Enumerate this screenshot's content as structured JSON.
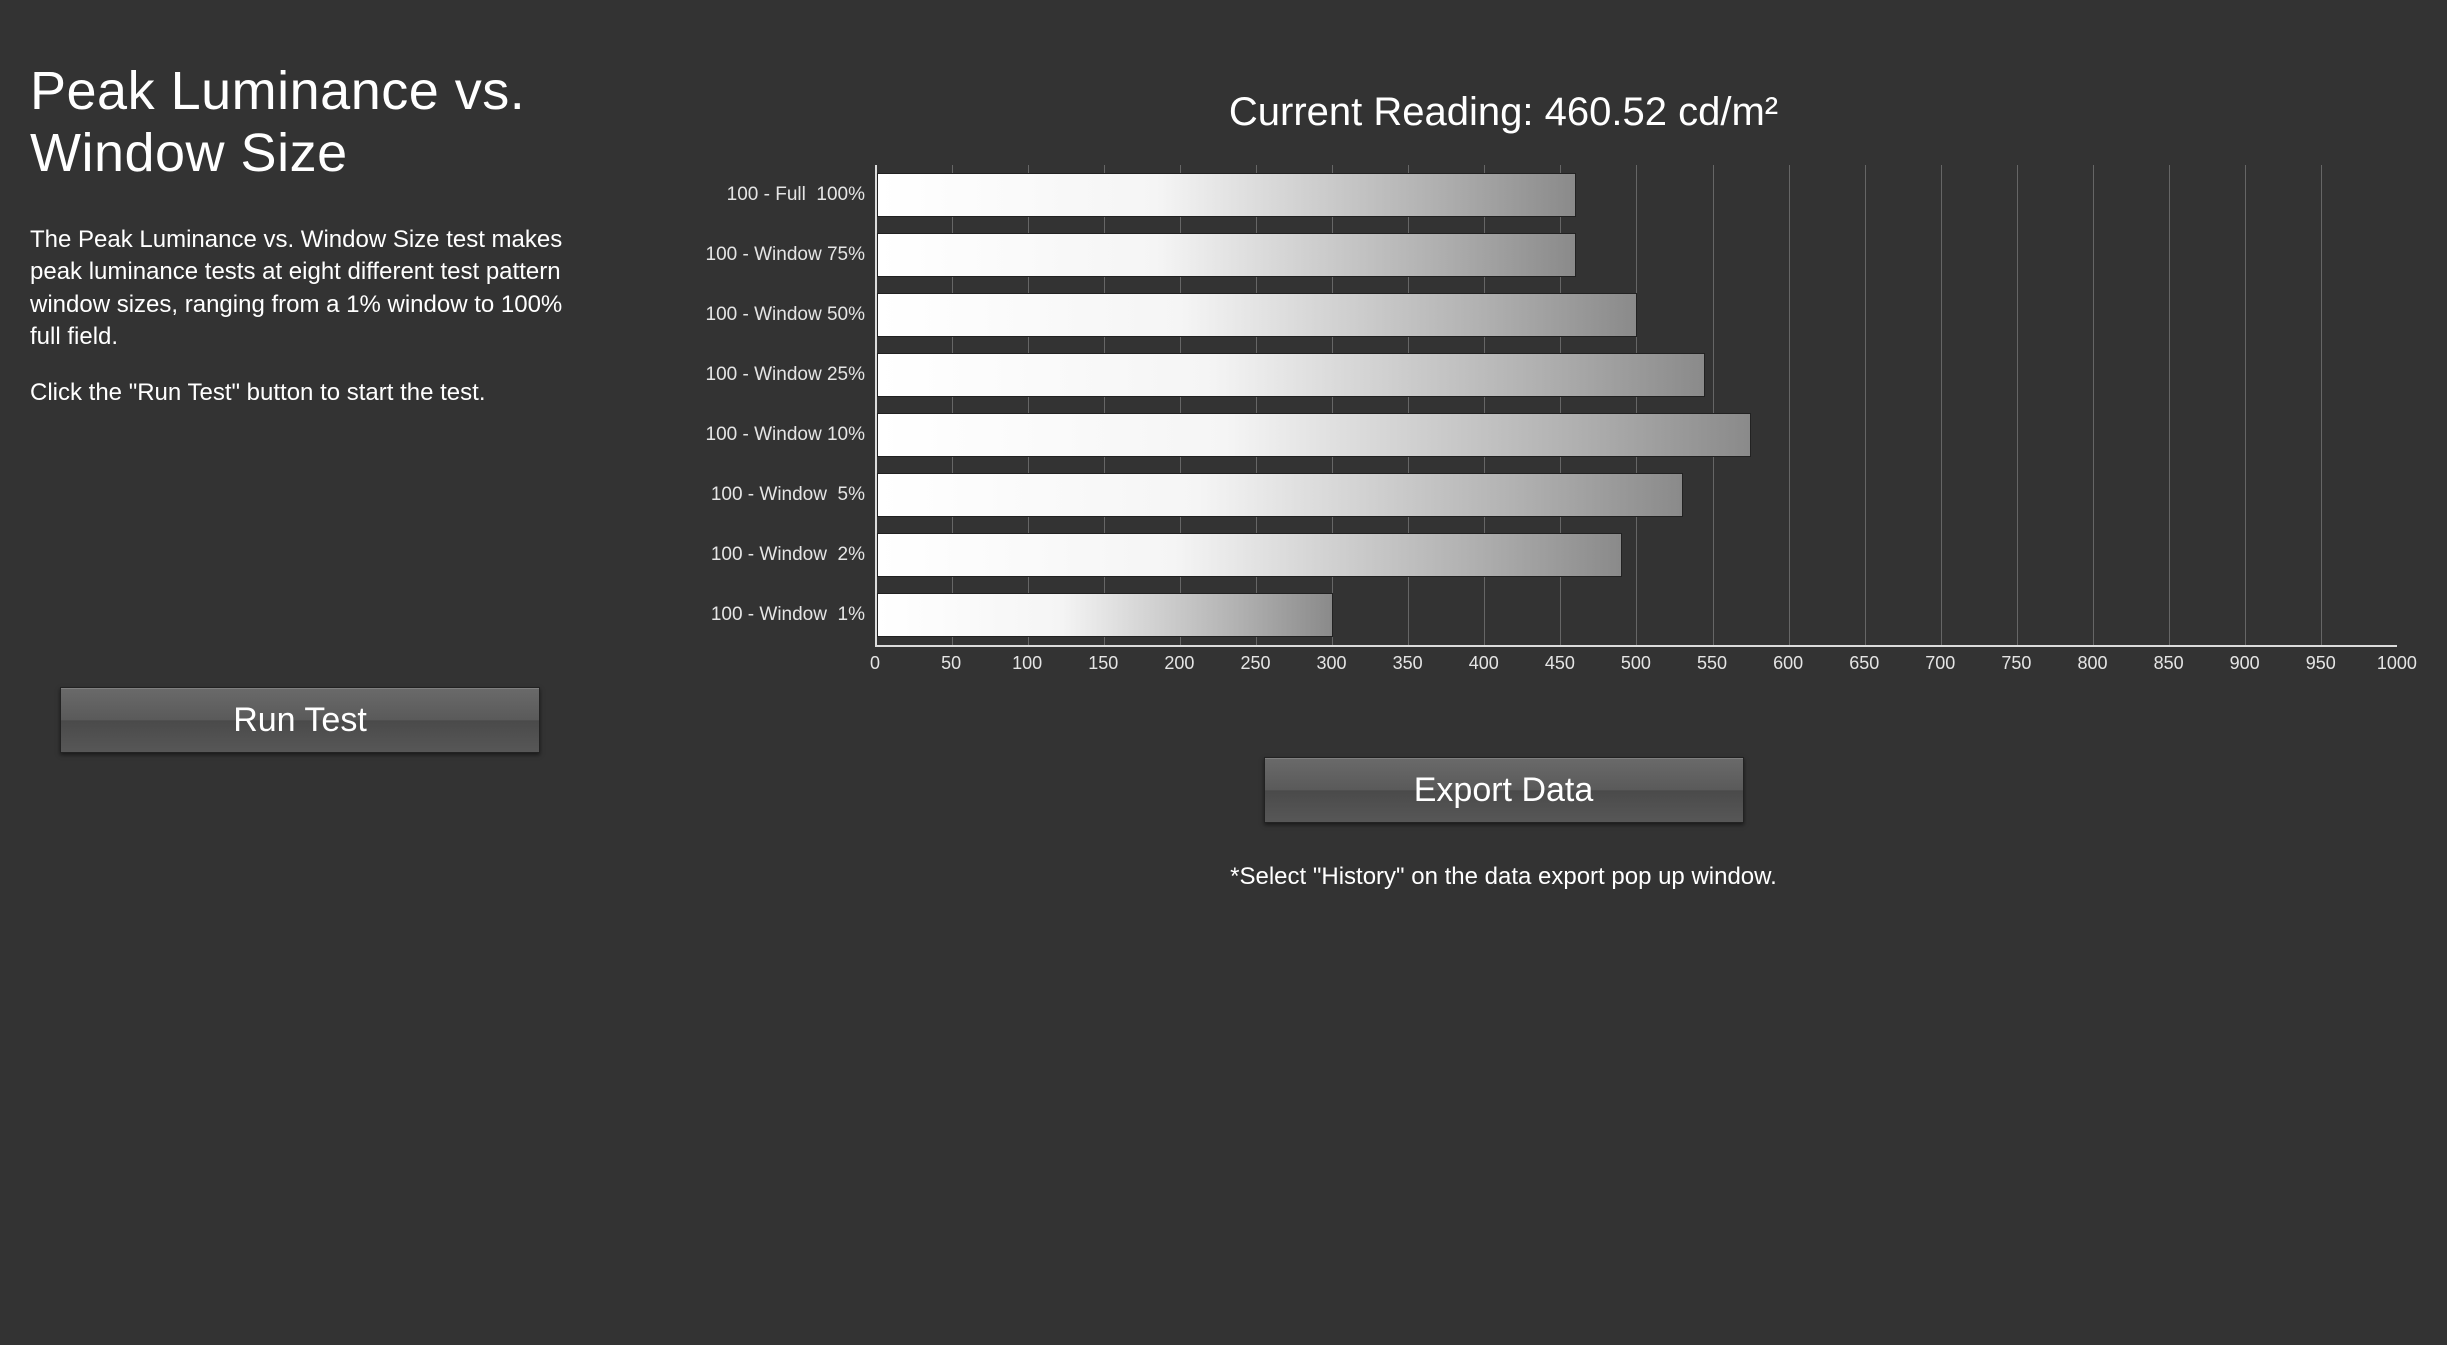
{
  "title": "Peak Luminance vs. Window Size",
  "description": "The Peak Luminance vs. Window Size test makes peak luminance tests at eight different test pattern window sizes, ranging from a 1% window to 100% full field.",
  "instruction": "Click the \"Run Test\" button to start the test.",
  "run_button_label": "Run Test",
  "current_reading_label": "Current Reading: 460.52 cd/m²",
  "export_button_label": "Export  Data",
  "export_note": "*Select \"History\" on the data export pop up window.",
  "chart_data": {
    "type": "bar",
    "orientation": "horizontal",
    "categories": [
      "100 - Full  100%",
      "100 - Window 75%",
      "100 - Window 50%",
      "100 - Window 25%",
      "100 - Window 10%",
      "100 - Window  5%",
      "100 - Window  2%",
      "100 - Window  1%"
    ],
    "values": [
      460,
      460,
      500,
      545,
      575,
      530,
      490,
      300
    ],
    "title": "",
    "xlabel": "",
    "ylabel": "",
    "xlim": [
      0,
      1000
    ],
    "x_ticks": [
      0,
      50,
      100,
      150,
      200,
      250,
      300,
      350,
      400,
      450,
      500,
      550,
      600,
      650,
      700,
      750,
      800,
      850,
      900,
      950,
      1000
    ]
  }
}
